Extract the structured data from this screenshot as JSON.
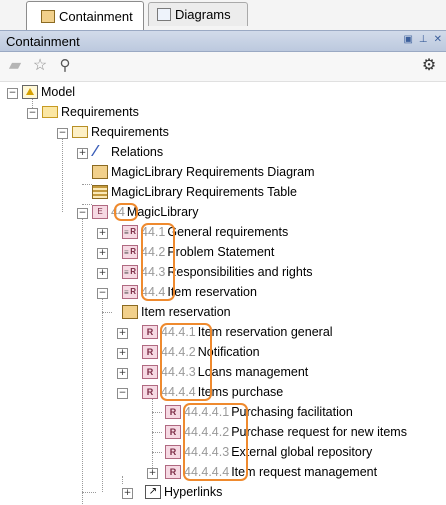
{
  "tabs": [
    {
      "label": "Containment",
      "icon": "containment-tab-icon"
    },
    {
      "label": "Diagrams",
      "icon": "diagrams-tab-icon"
    }
  ],
  "panel": {
    "title": "Containment"
  },
  "tree": {
    "model": "Model",
    "requirements_folder": "Requirements",
    "requirements_pkg": "Requirements",
    "relations": "Relations",
    "req_diagram": "MagicLibrary Requirements Diagram",
    "req_table": "MagicLibrary Requirements Table",
    "ml_num": "44",
    "ml_name": "MagicLibrary",
    "gen_num": "44.1",
    "gen_name": "General requirements",
    "prob_num": "44.2",
    "prob_name": "Problem Statement",
    "resp_num": "44.3",
    "resp_name": "Responsibilities and rights",
    "ir_num": "44.4",
    "ir_name": "Item reservation",
    "ir_diag": "Item reservation",
    "irg_num": "44.4.1",
    "irg_name": "Item reservation general",
    "not_num": "44.4.2",
    "not_name": "Notification",
    "loan_num": "44.4.3",
    "loan_name": "Loans management",
    "ip_num": "44.4.4",
    "ip_name": "Items purchase",
    "pf_num": "44.4.4.1",
    "pf_name": "Purchasing facilitation",
    "pr_num": "44.4.4.2",
    "pr_name": "Purchase request for new items",
    "eg_num": "44.4.4.3",
    "eg_name": "External global repository",
    "im_num": "44.4.4.4",
    "im_name": "Item request management",
    "hyper": "Hyperlinks"
  }
}
